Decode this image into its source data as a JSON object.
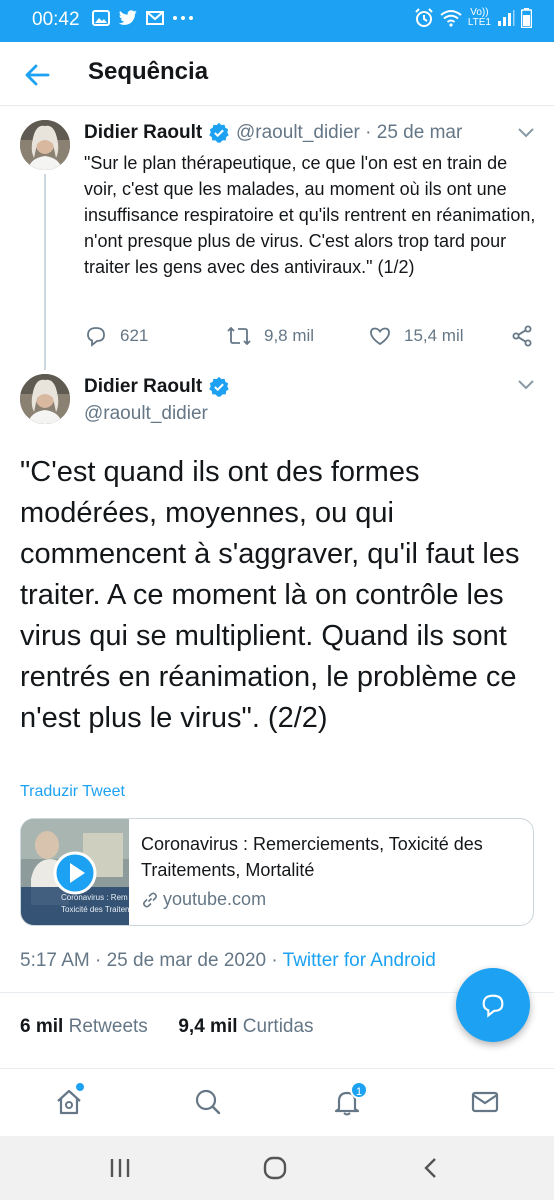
{
  "status_bar": {
    "time": "00:42",
    "network_top": "Vo))",
    "network_bottom": "LTE1"
  },
  "header": {
    "title": "Sequência",
    "back_icon": "arrow-left-icon"
  },
  "tweet1": {
    "name": "Didier Raoult",
    "handle": "@raoult_didier",
    "date": "· 25 de mar",
    "text": "\"Sur le plan thérapeutique, ce que l'on est en train de voir, c'est que les malades, au moment où ils ont une insuffisance respiratoire et qu'ils rentrent en réanimation, n'ont presque plus de virus. C'est alors trop tard pour traiter les gens avec des antiviraux.\" (1/2)",
    "replies": "621",
    "retweets": "9,8 mil",
    "likes": "15,4 mil"
  },
  "tweet2": {
    "name": "Didier Raoult",
    "handle": "@raoult_didier",
    "text": "\"C'est quand ils ont des formes modérées, moyennes, ou qui commencent à s'aggraver, qu'il faut les traiter. A ce moment là on contrôle les virus qui se multiplient. Quand ils sont rentrés en réanimation, le problème ce n'est plus le virus\". (2/2)",
    "translate": "Traduzir Tweet",
    "card": {
      "title": "Coronavirus : Remerciements, Toxicité des Traitements, Mortalité",
      "domain": "youtube.com",
      "thumb_line1": "Coronavirus : Rem",
      "thumb_line2": "Toxicité des Traitement"
    },
    "time": "5:17 AM · 25 de mar de 2020 ·",
    "source": "Twitter for Android",
    "retweet_count": "6 mil",
    "retweet_label": "Retweets",
    "like_count": "9,4 mil",
    "like_label": "Curtidas"
  },
  "bottom_nav": {
    "notification_badge": "1"
  },
  "colors": {
    "accent": "#1da1f2",
    "secondary_text": "#657786"
  }
}
